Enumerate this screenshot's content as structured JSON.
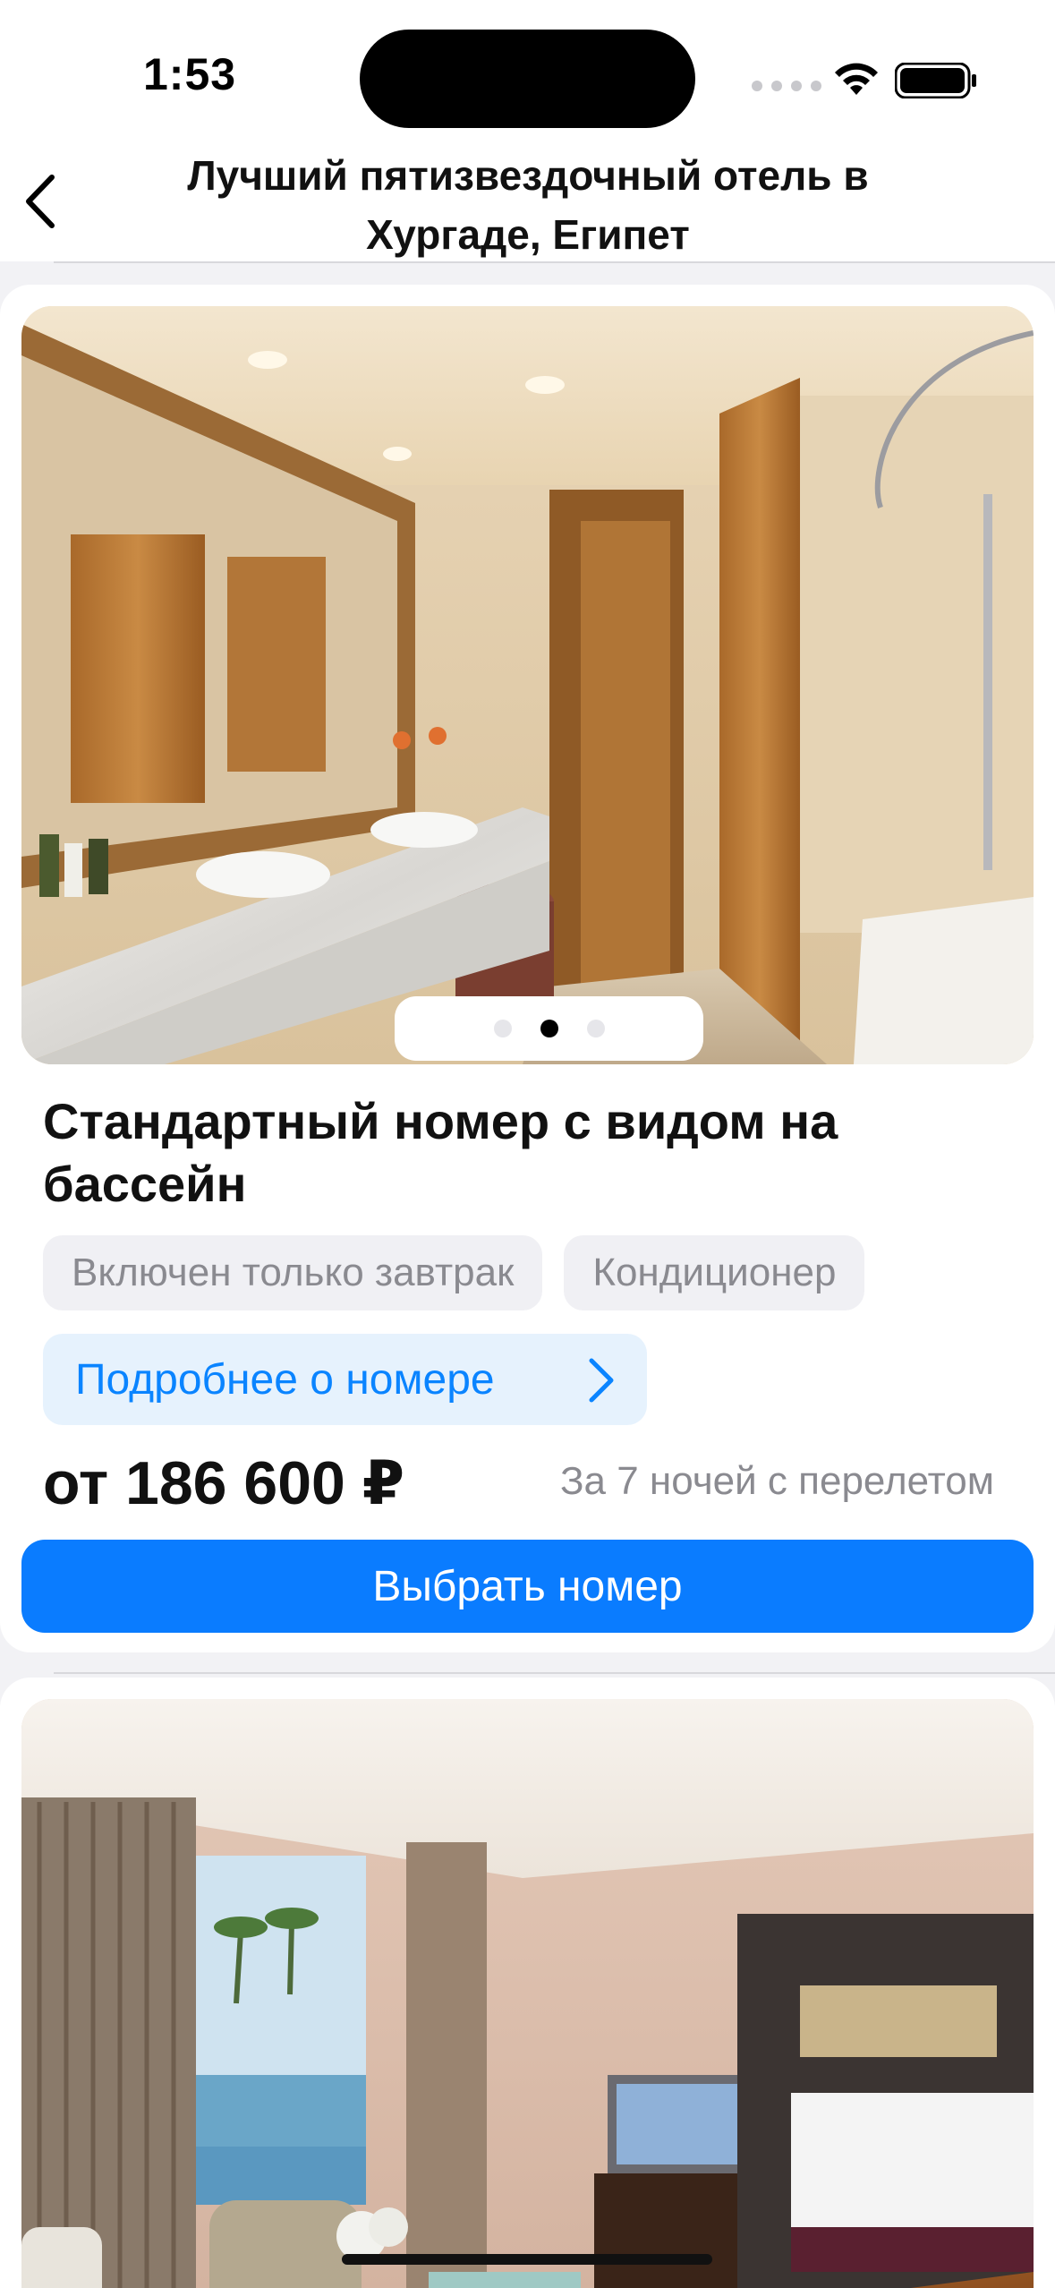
{
  "status_bar": {
    "time": "1:53"
  },
  "header": {
    "title": "Лучший пятизвездочный отель в Хургаде, Египет"
  },
  "rooms": [
    {
      "image_subject": "bathroom with marble double sink, mirror, wooden doors and bathtub",
      "pager": {
        "count": 3,
        "active_index": 1
      },
      "title": "Стандартный номер с видом на бассейн",
      "tags": [
        "Включен только завтрак",
        "Кондиционер"
      ],
      "details_label": "Подробнее о номере",
      "price": "от 186 600 ₽",
      "price_note": "За 7 ночей с перелетом",
      "select_label": "Выбрать номер"
    },
    {
      "image_subject": "bedroom with pool view, armchairs, TV and bed"
    }
  ],
  "colors": {
    "accent": "#0a7cff",
    "details_bg": "#e6f2fd",
    "tag_bg": "#f0f0f4",
    "muted_text": "#8a8a90",
    "page_bg": "#f2f2f5"
  }
}
